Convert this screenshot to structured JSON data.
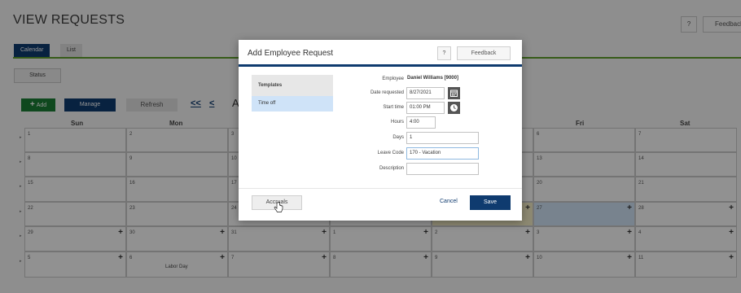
{
  "page": {
    "title": "VIEW REQUESTS",
    "help_label": "?",
    "feedback_label": "Feedback"
  },
  "tabs": [
    {
      "label": "Calendar"
    },
    {
      "label": "List"
    }
  ],
  "toolbar": {
    "status_label": "Status",
    "add_label": "Add",
    "manage_label": "Manage",
    "refresh_label": "Refresh",
    "prev_page": "<<",
    "prev": "<",
    "month_partial": "A"
  },
  "calendar": {
    "day_headers": [
      "Sun",
      "Mon",
      "Fri",
      "Sat"
    ],
    "weeks": [
      [
        "1",
        "2",
        "3",
        "",
        "",
        "6",
        "7"
      ],
      [
        "8",
        "9",
        "10",
        "",
        "",
        "13",
        "14"
      ],
      [
        "15",
        "16",
        "17",
        "",
        "",
        "20",
        "21"
      ],
      [
        "22",
        "23",
        "24",
        "",
        "",
        "27",
        "28"
      ],
      [
        "29",
        "30",
        "31",
        "1",
        "2",
        "3",
        "4"
      ],
      [
        "5",
        "6",
        "7",
        "8",
        "9",
        "10",
        "11"
      ]
    ],
    "holiday_label": "Labor Day"
  },
  "modal": {
    "title": "Add Employee Request",
    "help_label": "?",
    "feedback_label": "Feedback",
    "templates_header": "Templates",
    "template_items": [
      "Time off"
    ],
    "fields": {
      "employee_label": "Employee",
      "employee_value": "Daniel Williams [9000]",
      "date_requested_label": "Date requested",
      "date_requested_value": "8/27/2021",
      "start_time_label": "Start time",
      "start_time_value": "01:00 PM",
      "hours_label": "Hours",
      "hours_value": "4:00",
      "days_label": "Days",
      "days_value": "1",
      "leave_code_label": "Leave Code",
      "leave_code_value": "170 - Vacation",
      "description_label": "Description",
      "description_value": ""
    },
    "accruals_label": "Accruals",
    "cancel_label": "Cancel",
    "save_label": "Save"
  },
  "colors": {
    "primary": "#0f3b6f",
    "success": "#1b7d34",
    "accent_rule": "#5d9d2c",
    "highlight_blue": "#cfe2f5",
    "highlight_yellow": "#f3ecc4"
  }
}
